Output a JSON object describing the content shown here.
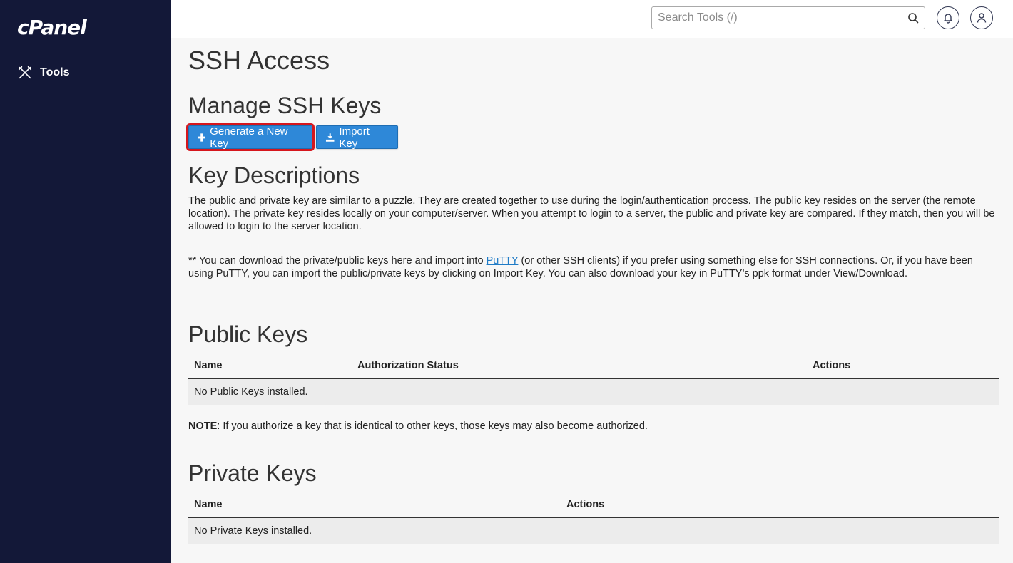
{
  "sidebar": {
    "logo": "cPanel",
    "items": [
      {
        "label": "Tools",
        "icon": "tools-icon"
      }
    ]
  },
  "topbar": {
    "search_placeholder": "Search Tools (/)",
    "icons": [
      "search-icon",
      "bell-icon",
      "user-icon"
    ]
  },
  "main": {
    "title": "SSH Access",
    "manage_heading": "Manage SSH Keys",
    "buttons": {
      "generate": "Generate a New Key",
      "import": "Import Key"
    },
    "key_desc_heading": "Key Descriptions",
    "desc1": "The public and private key are similar to a puzzle. They are created together to use during the login/authentication process. The public key resides on the server (the remote location). The private key resides locally on your computer/server. When you attempt to login to a server, the public and private key are compared. If they match, then you will be allowed to login to the server location.",
    "desc2_pre": "** You can download the private/public keys here and import into ",
    "desc2_link": "PuTTY",
    "desc2_post": " (or other SSH clients) if you prefer using something else for SSH connections. Or, if you have been using PuTTY, you can import the public/private keys by clicking on Import Key. You can also download your key in PuTTY’s ppk format under View/Download.",
    "public": {
      "heading": "Public Keys",
      "columns": [
        "Name",
        "Authorization Status",
        "Actions"
      ],
      "empty": "No Public Keys installed."
    },
    "note_label": "NOTE",
    "note_text": ": If you authorize a key that is identical to other keys, those keys may also become authorized.",
    "private": {
      "heading": "Private Keys",
      "columns": [
        "Name",
        "Actions"
      ],
      "empty": "No Private Keys installed."
    }
  },
  "colors": {
    "sidebar": "#131838",
    "button": "#2e88d8",
    "highlight": "#d6161d",
    "link": "#1f7bc6"
  }
}
